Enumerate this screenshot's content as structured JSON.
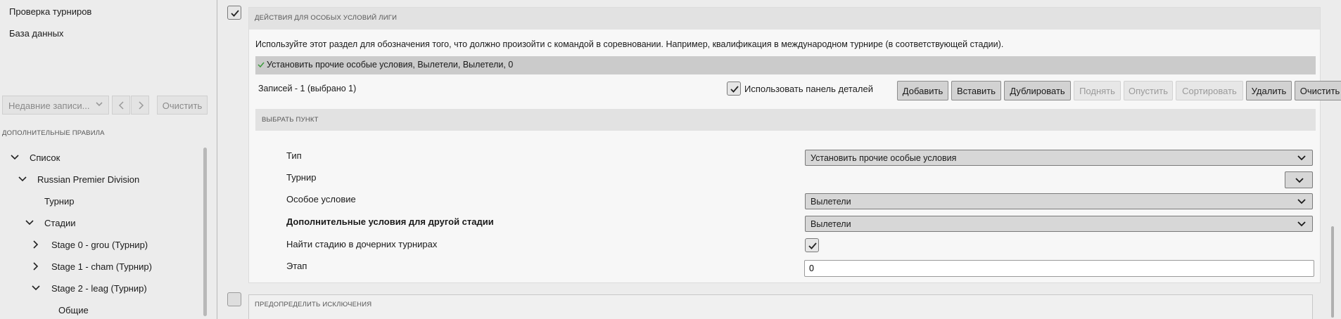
{
  "sidebar": {
    "links": [
      "Проверка турниров",
      "База данных"
    ],
    "recent": {
      "label": "Недавние записи...",
      "clear_label": "Очистить"
    },
    "section_title": "ДОПОЛНИТЕЛЬНЫЕ ПРАВИЛА",
    "tree": [
      {
        "label": "Список",
        "expanded": true
      },
      {
        "label": "Russian Premier Division",
        "expanded": true
      },
      {
        "label": "Турнир"
      },
      {
        "label": "Стадии",
        "expanded": true
      },
      {
        "label": "Stage 0 - grou (Турнир)",
        "expanded": false
      },
      {
        "label": "Stage 1 - cham (Турнир)",
        "expanded": false
      },
      {
        "label": "Stage 2 - leag (Турнир)",
        "expanded": true
      },
      {
        "label": "Общие"
      }
    ]
  },
  "main": {
    "panel1": {
      "checked": true,
      "title": "ДЕЙСТВИЯ ДЛЯ ОСОБЫХ УСЛОВИЙ ЛИГИ",
      "description": "Используйте этот раздел для обозначения того, что должно произойти с командой в соревновании. Например, квалификация в международном турнире (в соответствующей стадии).",
      "selected_item": "Установить прочие особые условия, Вылетели, Вылетели, 0",
      "records": "Записей - 1 (выбрано 1)",
      "use_details_label": "Использовать панель деталей",
      "use_details_checked": true,
      "buttons": {
        "add": "Добавить",
        "insert": "Вставить",
        "duplicate": "Дублировать",
        "up": "Поднять",
        "down": "Опустить",
        "sort": "Сортировать",
        "delete": "Удалить",
        "clear": "Очистить"
      },
      "detail": {
        "title": "ВЫБРАТЬ ПУНКТ",
        "type_label": "Тип",
        "type_value": "Установить прочие особые условия",
        "tournament_label": "Турнир",
        "special_label": "Особое условие",
        "special_value": "Вылетели",
        "extra_label": "Дополнительные условия для другой стадии",
        "extra_value": "Вылетели",
        "find_stage_label": "Найти стадию в дочерних турнирах",
        "find_stage_checked": true,
        "stage_label": "Этап",
        "stage_value": "0"
      }
    },
    "panel2": {
      "checked": false,
      "title": "ПРЕДОПРЕДЕЛИТЬ ИСКЛЮЧЕНИЯ"
    }
  }
}
